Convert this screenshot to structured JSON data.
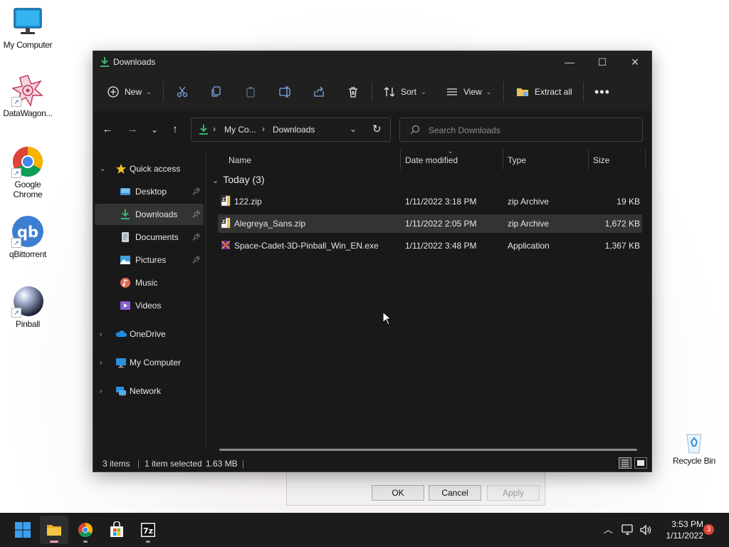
{
  "desktop": {
    "icons": [
      {
        "label": "My Computer",
        "name": "my-computer"
      },
      {
        "label": "DataWagon...",
        "name": "datawagon"
      },
      {
        "label": "Google Chrome",
        "name": "google-chrome"
      },
      {
        "label": "qBittorrent",
        "name": "qbittorrent"
      },
      {
        "label": "Pinball",
        "name": "pinball"
      },
      {
        "label": "Recycle Bin",
        "name": "recycle-bin"
      }
    ]
  },
  "dialog": {
    "ok": "OK",
    "cancel": "Cancel",
    "apply": "Apply"
  },
  "window": {
    "title": "Downloads",
    "toolbar": {
      "new": "New",
      "sort": "Sort",
      "view": "View",
      "extract_all": "Extract all"
    },
    "address": {
      "crumbs": [
        "My Co...",
        "Downloads"
      ]
    },
    "search": {
      "placeholder": "Search Downloads"
    },
    "nav": {
      "quick_access": "Quick access",
      "items": [
        "Desktop",
        "Downloads",
        "Documents",
        "Pictures",
        "Music",
        "Videos"
      ],
      "onedrive": "OneDrive",
      "my_computer": "My Computer",
      "network": "Network"
    },
    "columns": {
      "name": "Name",
      "date": "Date modified",
      "type": "Type",
      "size": "Size"
    },
    "group": "Today (3)",
    "files": [
      {
        "name": "122.zip",
        "date": "1/11/2022 3:18 PM",
        "type": "zip Archive",
        "size": "19 KB"
      },
      {
        "name": "Alegreya_Sans.zip",
        "date": "1/11/2022 2:05 PM",
        "type": "zip Archive",
        "size": "1,672 KB"
      },
      {
        "name": "Space-Cadet-3D-Pinball_Win_EN.exe",
        "date": "1/11/2022 3:48 PM",
        "type": "Application",
        "size": "1,367 KB"
      }
    ],
    "status": {
      "items": "3 items",
      "selected": "1 item selected",
      "size": "1.63 MB"
    }
  },
  "taskbar": {
    "time": "3:53 PM",
    "date": "1/11/2022",
    "notification_count": "3",
    "apps": [
      "start",
      "file-explorer",
      "chrome",
      "store",
      "7zip"
    ]
  },
  "colors": {
    "window_bg": "#191919",
    "selection": "#333333",
    "accent_download": "#3bb273",
    "taskbar": "#1c1c1c",
    "badge": "#d9453a"
  }
}
